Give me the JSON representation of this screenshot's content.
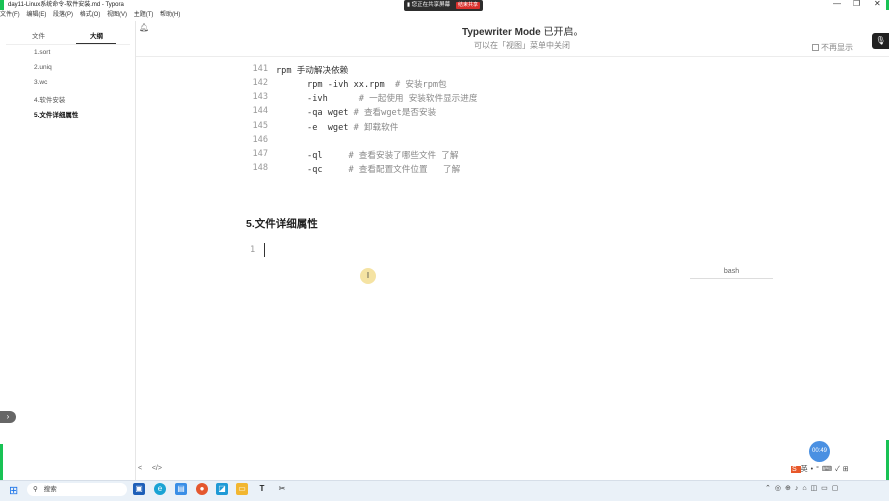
{
  "window": {
    "title": "day11-Linux系统命令-软件安装.md - Typora",
    "menu": [
      "文件(F)",
      "编辑(E)",
      "段落(P)",
      "格式(O)",
      "视图(V)",
      "主题(T)",
      "帮助(H)"
    ],
    "controls": {
      "minimize": "—",
      "maximize": "❐",
      "close": "✕"
    }
  },
  "share_banner": {
    "text": "您正在共享屏幕",
    "stop_label": "结束共享"
  },
  "sidebar": {
    "tabs": {
      "files": "文件",
      "outline": "大纲"
    },
    "outline_items": [
      {
        "label": "1.sort",
        "active": false
      },
      {
        "label": "2.uniq",
        "active": false
      },
      {
        "label": "3.wc",
        "active": false
      },
      {
        "label": "4.软件安装",
        "active": false
      },
      {
        "label": "5.文件详细属性",
        "active": true
      }
    ]
  },
  "typewriter": {
    "title_main": "Typewriter Mode",
    "title_suffix": " 已开启。",
    "subtitle": "可以在「视图」菜单中关闭",
    "hide_label": "不再显示"
  },
  "code_block_1": {
    "lines": [
      {
        "num": "141",
        "text": "rpm 手动解决依赖",
        "comment": ""
      },
      {
        "num": "142",
        "text": "      rpm -ivh xx.rpm  ",
        "comment": "# 安装rpm包"
      },
      {
        "num": "143",
        "text": "      -ivh      ",
        "comment": "# 一起使用 安装软件显示进度"
      },
      {
        "num": "144",
        "text": "      -qa wget ",
        "comment": "# 查看wget是否安装"
      },
      {
        "num": "145",
        "text": "      -e  wget ",
        "comment": "# 卸载软件"
      },
      {
        "num": "146",
        "text": "",
        "comment": ""
      },
      {
        "num": "147",
        "text": "      -ql     ",
        "comment": "# 查看安装了哪些文件 了解"
      },
      {
        "num": "148",
        "text": "      -qc     ",
        "comment": "# 查看配置文件位置   了解"
      }
    ]
  },
  "heading": "5.文件详细属性",
  "code_block_2": {
    "line_num": "1",
    "language": "bash"
  },
  "cursor_glyph": "I",
  "bottom_bar": {
    "left_arrow": "<",
    "source_toggle": "</>"
  },
  "timer": "00:49",
  "taskbar": {
    "search_placeholder": "搜索",
    "typora_label": "T"
  }
}
